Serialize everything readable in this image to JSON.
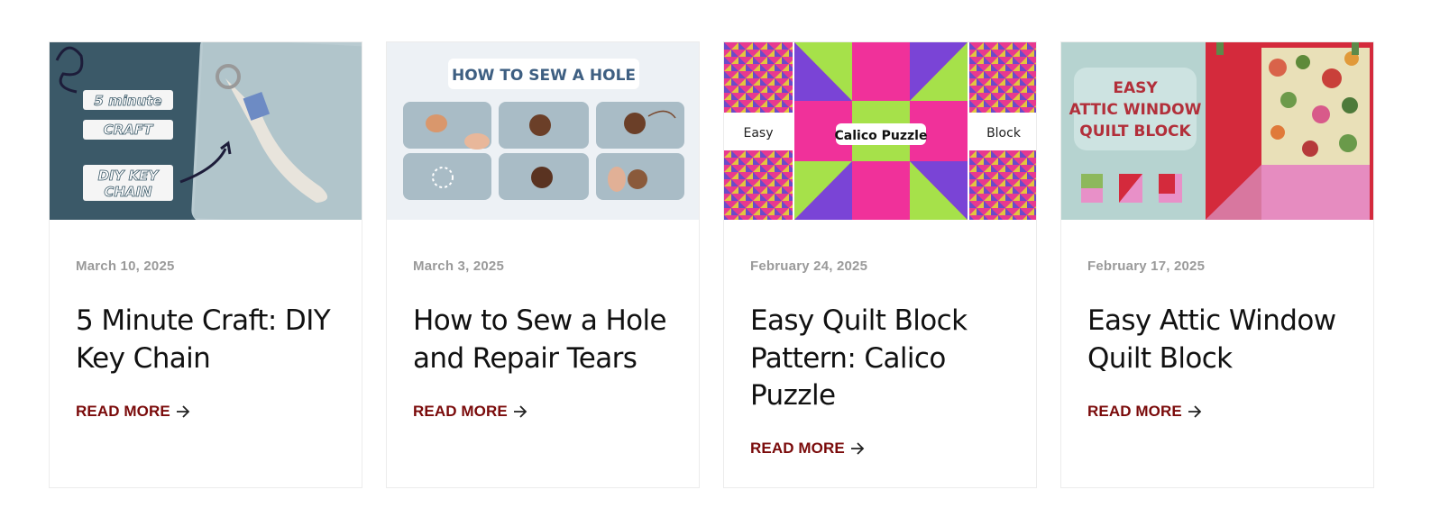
{
  "posts": [
    {
      "date": "March 10, 2025",
      "title": "5 Minute Craft: DIY Key Chain",
      "read_more": "READ MORE",
      "image_text": [
        "5 minute",
        "CRAFT",
        "DIY KEY",
        "CHAIN"
      ]
    },
    {
      "date": "March 3, 2025",
      "title": "How to Sew a Hole and Repair Tears",
      "read_more": "READ MORE",
      "image_text": [
        "HOW TO SEW A HOLE"
      ]
    },
    {
      "date": "February 24, 2025",
      "title": "Easy Quilt Block Pattern: Calico Puzzle",
      "read_more": "READ MORE",
      "image_text": [
        "Easy",
        "Calico Puzzle",
        "Block"
      ]
    },
    {
      "date": "February 17, 2025",
      "title": "Easy Attic Window Quilt Block",
      "read_more": "READ MORE",
      "image_text": [
        "EASY",
        "ATTIC WINDOW",
        "QUILT BLOCK"
      ]
    }
  ],
  "colors": {
    "accent": "#7a0a0a",
    "date": "#9a9a9a",
    "border": "#ececec"
  },
  "icons": {
    "read_more": "arrow-right-icon"
  }
}
